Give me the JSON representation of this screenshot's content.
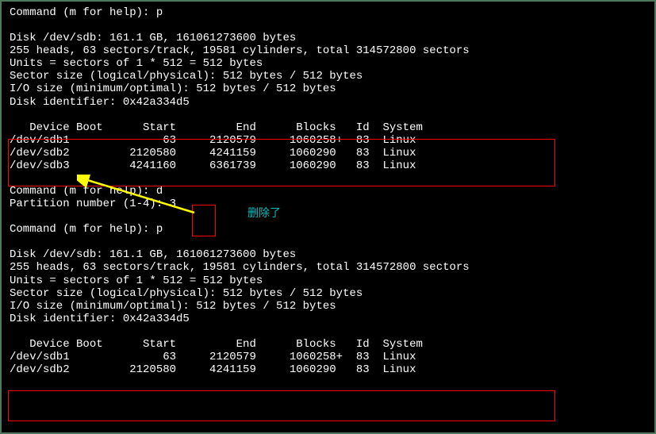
{
  "prompt1": "Command (m for help): p",
  "disk_info1": "Disk /dev/sdb: 161.1 GB, 161061273600 bytes\n255 heads, 63 sectors/track, 19581 cylinders, total 314572800 sectors\nUnits = sectors of 1 * 512 = 512 bytes\nSector size (logical/physical): 512 bytes / 512 bytes\nI/O size (minimum/optimal): 512 bytes / 512 bytes\nDisk identifier: 0x42a334d5",
  "header1": "   Device Boot      Start         End      Blocks   Id  System",
  "rows1": [
    "/dev/sdb1              63     2120579     1060258+  83  Linux",
    "/dev/sdb2         2120580     4241159     1060290   83  Linux",
    "/dev/sdb3         4241160     6361739     1060290   83  Linux"
  ],
  "delete_cmd": "Command (m for help): d",
  "partition_prompt": "Partition number (1-4): 3",
  "prompt2": "Command (m for help): p",
  "disk_info2": "Disk /dev/sdb: 161.1 GB, 161061273600 bytes\n255 heads, 63 sectors/track, 19581 cylinders, total 314572800 sectors\nUnits = sectors of 1 * 512 = 512 bytes\nSector size (logical/physical): 512 bytes / 512 bytes\nI/O size (minimum/optimal): 512 bytes / 512 bytes\nDisk identifier: 0x42a334d5",
  "header2": "   Device Boot      Start         End      Blocks   Id  System",
  "rows2": [
    "/dev/sdb1              63     2120579     1060258+  83  Linux",
    "/dev/sdb2         2120580     4241159     1060290   83  Linux"
  ],
  "annotation1": "删除了"
}
